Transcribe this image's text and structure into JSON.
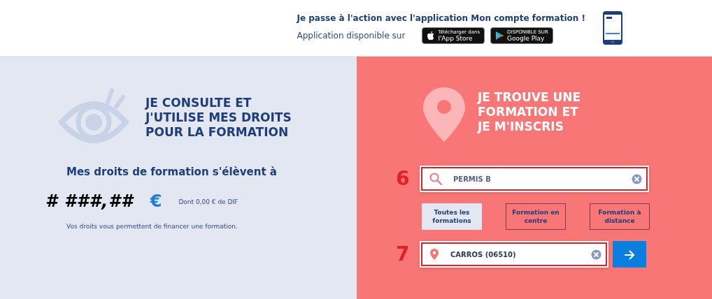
{
  "app_banner": {
    "headline": "Je passe à l'action avec l'application Mon compte formation !",
    "availability": "Application disponible sur",
    "stores": [
      {
        "kind": "apple",
        "caption": "Télécharger dans",
        "name": "l'App Store"
      },
      {
        "kind": "google",
        "caption": "DISPONIBLE SUR",
        "name": "Google Play"
      }
    ]
  },
  "rights_panel": {
    "title": "JE CONSULTE ET J'UTILISE MES DROITS POUR LA FORMATION",
    "amount_label": "Mes droits de formation s'élèvent à",
    "amount": "# ###,##",
    "currency": "€",
    "dif_note": "Dont 0,00 € de DIF",
    "description": "Vos droits vous permettent de financer une formation."
  },
  "search_panel": {
    "title": "JE TROUVE UNE FORMATION ET JE M'INSCRIS",
    "search_field": {
      "marker": "6",
      "value": "PERMIS B"
    },
    "filters": [
      {
        "label": "Toutes les formations",
        "selected": true
      },
      {
        "label": "Formation en centre",
        "selected": false
      },
      {
        "label": "Formation à distance",
        "selected": false
      }
    ],
    "location_field": {
      "marker": "7",
      "value": "CARROS (06510)"
    }
  }
}
